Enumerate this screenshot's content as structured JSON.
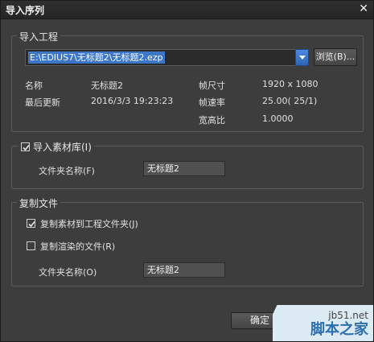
{
  "window": {
    "title": "导入序列",
    "close_glyph": "✕"
  },
  "project_group": {
    "legend": "导入工程",
    "path": "E:\\EDIUS7\\无标题2\\无标题2.ezp",
    "browse_label": "浏览(B)...",
    "info": {
      "name_label": "名称",
      "name_value": "无标题2",
      "updated_label": "最后更新",
      "updated_value": "2016/3/3 19:23:23",
      "frame_size_label": "帧尺寸",
      "frame_size_value": "1920 x 1080",
      "frame_rate_label": "帧速率",
      "frame_rate_value": "25.00( 25/1)",
      "aspect_label": "宽高比",
      "aspect_value": "1.0000"
    }
  },
  "bin_group": {
    "checkbox_label": "导入素材库(I)",
    "checked": true,
    "folder_label": "文件夹名称(F)",
    "folder_value": "无标题2"
  },
  "copy_group": {
    "legend": "复制文件",
    "copy_clips_label": "复制素材到工程文件夹(J)",
    "copy_clips_checked": true,
    "copy_rendered_label": "复制渲染的文件(R)",
    "copy_rendered_checked": false,
    "folder_label": "文件夹名称(O)",
    "folder_value": "无标题2"
  },
  "footer": {
    "ok_label": "确定"
  },
  "watermark": {
    "site": "jb51.net",
    "brand": "脚本之家"
  }
}
